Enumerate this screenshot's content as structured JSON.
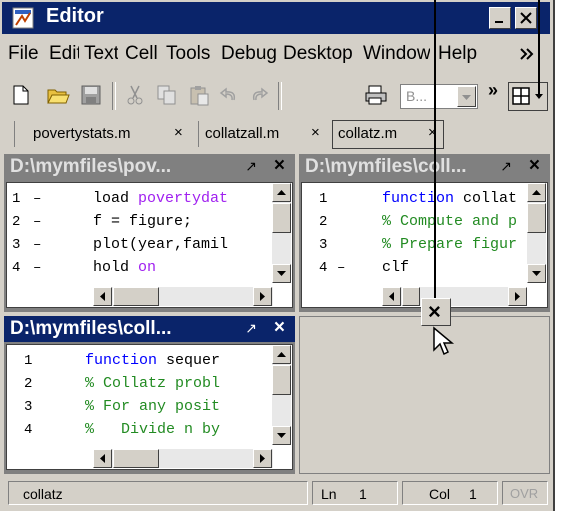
{
  "window": {
    "title": "Editor"
  },
  "menu": [
    "File",
    "Edit",
    "Text",
    "Cell",
    "Tools",
    "Debug",
    "Desktop",
    "Window",
    "Help"
  ],
  "toolbar": {
    "buttons": [
      "new-file-icon",
      "open-folder-icon",
      "save-icon",
      "cut-icon",
      "copy-icon",
      "paste-icon",
      "undo-icon",
      "redo-icon",
      "print-icon"
    ],
    "combo_value": "B...",
    "overflow_label": "»"
  },
  "tabs": [
    {
      "label": "povertystats.m",
      "close": "×"
    },
    {
      "label": "collatzall.m",
      "close": "×"
    },
    {
      "label": "collatz.m",
      "close": "×"
    }
  ],
  "panes": [
    {
      "title": "D:\\mymfiles\\pov...",
      "active": false,
      "pin": "↗",
      "close": "×",
      "lines": [
        {
          "num": "1",
          "mark": "–",
          "segments": [
            {
              "text": "load ",
              "color": "#000000"
            },
            {
              "text": "povertydat",
              "color": "#a020f0"
            }
          ]
        },
        {
          "num": "2",
          "mark": "–",
          "segments": [
            {
              "text": "f = figure;",
              "color": "#000000"
            }
          ]
        },
        {
          "num": "3",
          "mark": "–",
          "segments": [
            {
              "text": "plot(year,famil",
              "color": "#000000"
            }
          ]
        },
        {
          "num": "4",
          "mark": "–",
          "segments": [
            {
              "text": "hold ",
              "color": "#000000"
            },
            {
              "text": "on",
              "color": "#a020f0"
            }
          ]
        }
      ]
    },
    {
      "title": "D:\\mymfiles\\coll...",
      "active": false,
      "pin": "↗",
      "close": "×",
      "lines": [
        {
          "num": "1",
          "mark": "",
          "segments": [
            {
              "text": "function ",
              "color": "#0000ff"
            },
            {
              "text": "collat",
              "color": "#000000"
            }
          ]
        },
        {
          "num": "2",
          "mark": "",
          "segments": [
            {
              "text": "% Compute and p",
              "color": "#228b22"
            }
          ]
        },
        {
          "num": "3",
          "mark": "",
          "segments": [
            {
              "text": "% Prepare figur",
              "color": "#228b22"
            }
          ]
        },
        {
          "num": "4",
          "mark": "–",
          "segments": [
            {
              "text": "clf",
              "color": "#000000"
            }
          ]
        }
      ]
    },
    {
      "title": "D:\\mymfiles\\coll...",
      "active": true,
      "pin": "↗",
      "close": "×",
      "lines": [
        {
          "num": "1",
          "mark": "",
          "segments": [
            {
              "text": "function ",
              "color": "#0000ff"
            },
            {
              "text": "sequer",
              "color": "#000000"
            }
          ]
        },
        {
          "num": "2",
          "mark": "",
          "segments": [
            {
              "text": "% Collatz probl",
              "color": "#228b22"
            }
          ]
        },
        {
          "num": "3",
          "mark": "",
          "segments": [
            {
              "text": "% For any posit",
              "color": "#228b22"
            }
          ]
        },
        {
          "num": "4",
          "mark": "",
          "segments": [
            {
              "text": "%   Divide n by",
              "color": "#228b22"
            }
          ]
        }
      ]
    }
  ],
  "floating_close": "×",
  "status": {
    "file": "collatz",
    "ln_label": "Ln",
    "ln_value": "1",
    "col_label": "Col",
    "col_value": "1",
    "ovr": "OVR"
  },
  "colors": {
    "title_active": "#0a246a",
    "chrome": "#d4d0c8",
    "keyword": "#0000ff",
    "comment": "#228b22",
    "string": "#a020f0"
  }
}
